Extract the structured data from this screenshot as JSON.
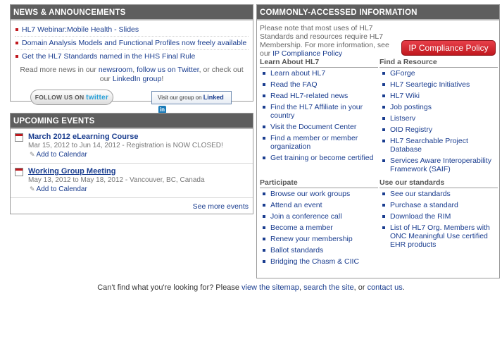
{
  "news": {
    "heading": "NEWS & ANNOUNCEMENTS",
    "items": [
      "HL7 Webinar:Mobile Health - Slides",
      "Domain Analysis Models and Functional Profiles now freely available",
      "Get the HL7 Standards named in the HHS Final Rule"
    ],
    "more": {
      "prefix": "Read more news in our ",
      "newsroom": "newsroom",
      "sep1": ", ",
      "twitter_link": "follow us on Twitter",
      "sep2": ", or check out our ",
      "linkedin_link": "LinkedIn group",
      "suffix": "!"
    },
    "twitter_btn": {
      "label": "FOLLOW US ON",
      "brand": "twitter"
    },
    "linkedin_btn": {
      "label": "Visit our group on",
      "brand": "Linked",
      "in": "in"
    }
  },
  "events": {
    "heading": "UPCOMING EVENTS",
    "items": [
      {
        "title": "March 2012 eLearning Course",
        "detail": "Mar 15, 2012 to Jun 14, 2012 - Registration is NOW CLOSED!",
        "add": "Add to Calendar"
      },
      {
        "title": "Working Group Meeting",
        "detail": "May 13, 2012 to May 18, 2012 - Vancouver, BC, Canada",
        "add": "Add to Calendar"
      }
    ],
    "see_more": "See more events"
  },
  "common": {
    "heading": "COMMONLY-ACCESSED INFORMATION",
    "intro": "Please note that most uses of HL7 Standards and resources require HL7 Membership. For more information, see our ",
    "intro_link": "IP Compliance Policy",
    "ip_button": "IP Compliance Policy",
    "learn": {
      "title": "Learn About HL7",
      "items": [
        "Learn about HL7",
        "Read the FAQ",
        "Read HL7-related news",
        "Find the HL7 Affiliate in your country",
        "Visit the Document Center",
        "Find a member or member organization",
        "Get training or become certified"
      ]
    },
    "resource": {
      "title": "Find a Resource",
      "items": [
        "GForge",
        "HL7 Seartegic Initiatives",
        "HL7 Wiki",
        "Job postings",
        "Listserv",
        "OID Registry",
        "HL7 Searchable Project Database",
        "Services Aware Interoperability Framework (SAIF)"
      ]
    },
    "participate": {
      "title": "Participate",
      "items": [
        "Browse our work groups",
        "Attend an event",
        "Join a conference call",
        "Become a member",
        "Renew your membership",
        "Ballot standards",
        "Bridging the Chasm & CIIC"
      ]
    },
    "standards": {
      "title": "Use our standards",
      "items": [
        "See our standards",
        "Purchase a standard",
        "Download the RIM",
        "List of HL7 Org. Members with ONC Meaningful Use certified EHR products"
      ]
    }
  },
  "footer": {
    "prefix": "Can't find what you're looking for? Please ",
    "sitemap": "view the sitemap",
    "sep1": ", ",
    "search": "search the site",
    "sep2": ", or ",
    "contact": "contact us",
    "suffix": "."
  }
}
